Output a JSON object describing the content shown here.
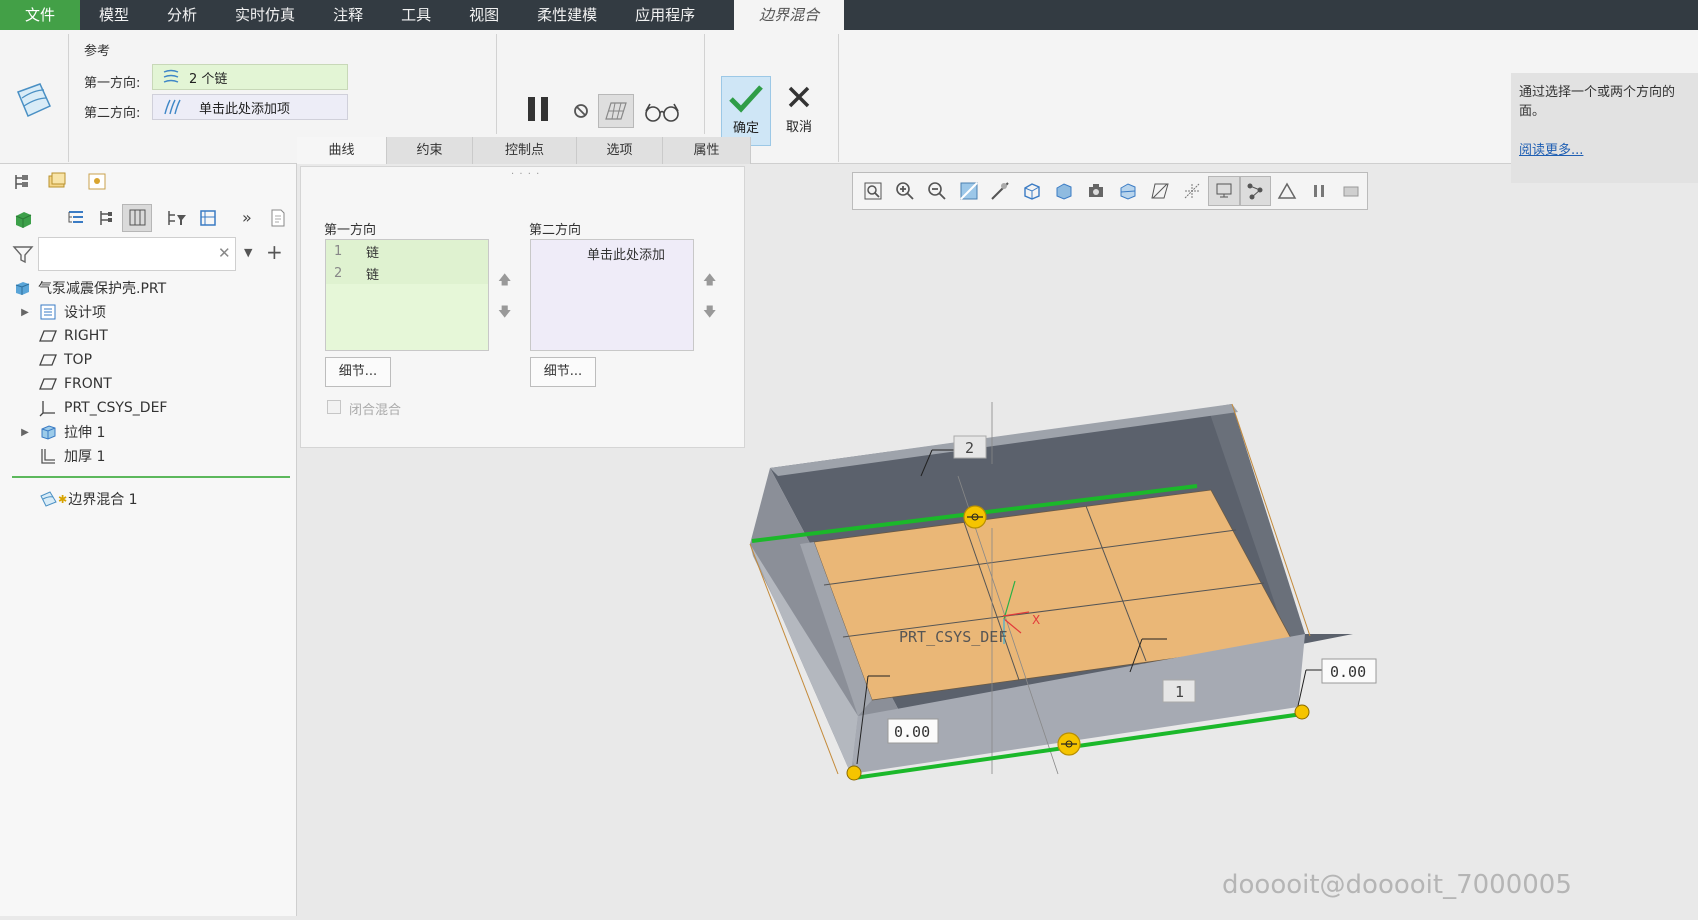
{
  "menu": {
    "file": "文件",
    "tabs": [
      "模型",
      "分析",
      "实时仿真",
      "注释",
      "工具",
      "视图",
      "柔性建模",
      "应用程序"
    ],
    "active": "边界混合"
  },
  "ribbon": {
    "ref_group_label": "参考",
    "dir1_label": "第一方向:",
    "dir1_value": "2 个链",
    "dir2_label": "第二方向:",
    "dir2_value": "单击此处添加项",
    "ok_label": "确定",
    "cancel_label": "取消",
    "help_text": "通过选择一个或两个方向的面。",
    "help_link": "阅读更多..."
  },
  "subtabs": [
    "曲线",
    "约束",
    "控制点",
    "选项",
    "属性"
  ],
  "model_tree": {
    "root": "气泵减震保护壳.PRT",
    "items": [
      {
        "label": "设计项",
        "expandable": true,
        "icon": "layers-icon"
      },
      {
        "label": "RIGHT",
        "expandable": false,
        "icon": "datum-plane-icon"
      },
      {
        "label": "TOP",
        "expandable": false,
        "icon": "datum-plane-icon"
      },
      {
        "label": "FRONT",
        "expandable": false,
        "icon": "datum-plane-icon"
      },
      {
        "label": "PRT_CSYS_DEF",
        "expandable": false,
        "icon": "csys-icon"
      },
      {
        "label": "拉伸 1",
        "expandable": true,
        "icon": "extrude-icon"
      },
      {
        "label": "加厚 1",
        "expandable": false,
        "icon": "thicken-icon"
      }
    ],
    "current": "边界混合 1"
  },
  "curves_panel": {
    "dir1_title": "第一方向",
    "dir1_rows": [
      {
        "num": "1",
        "value": "链"
      },
      {
        "num": "2",
        "value": "链"
      }
    ],
    "dir2_title": "第二方向",
    "dir2_placeholder": "单击此处添加",
    "details_label": "细节...",
    "closed_blend_label": "闭合混合"
  },
  "viewport": {
    "csys_label": "PRT_CSYS_DEF",
    "axis_x": "X",
    "chain_label_1": "1",
    "chain_label_2": "2",
    "dim_values": [
      "0.00",
      "0.00"
    ]
  },
  "watermark": "dooooit@dooooit_7000005",
  "colors": {
    "menubar_bg": "#333b42",
    "file_tab": "#43a047",
    "chain_green": "#1bb82a",
    "handle_yellow": "#f5c400",
    "face_orange": "#eab777",
    "body_gray": "#a6aab3"
  }
}
